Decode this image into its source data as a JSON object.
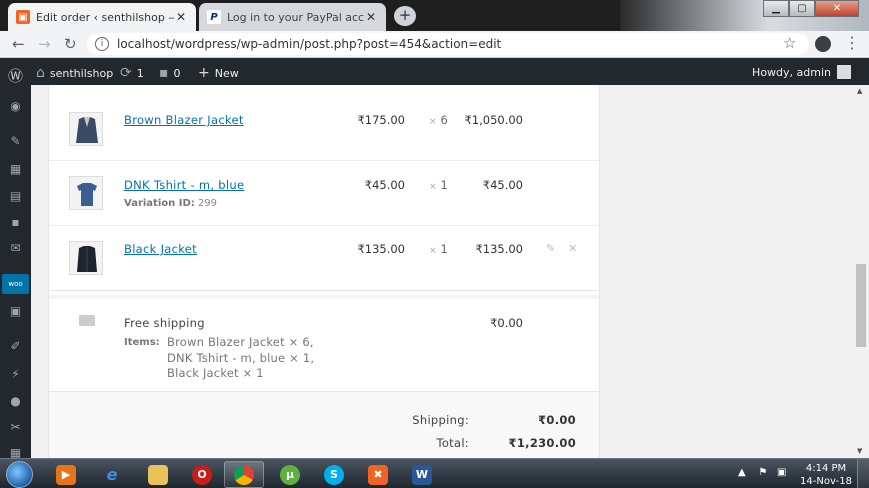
{
  "browser": {
    "tabs": [
      {
        "title": "Edit order ‹ senthilshop — Word",
        "active": true
      },
      {
        "title": "Log in to your PayPal account",
        "active": false
      }
    ],
    "url": "localhost/wordpress/wp-admin/post.php?post=454&action=edit"
  },
  "adminbar": {
    "site_name": "senthilshop",
    "updates_count": "1",
    "comments_count": "0",
    "new_label": "New",
    "greeting": "Howdy, admin"
  },
  "order_items": [
    {
      "name": "Brown Blazer Jacket",
      "cost": "₹175.00",
      "qty": "6",
      "total": "₹1,050.00"
    },
    {
      "name": "DNK Tshirt - m, blue",
      "variation_label": "Variation ID:",
      "variation_id": "299",
      "cost": "₹45.00",
      "qty": "1",
      "total": "₹45.00"
    },
    {
      "name": "Black Jacket",
      "cost": "₹135.00",
      "qty": "1",
      "total": "₹135.00"
    }
  ],
  "shipping": {
    "method": "Free shipping",
    "cost": "₹0.00",
    "items_label": "Items:",
    "items_lines": [
      "Brown Blazer Jacket × 6,",
      "DNK Tshirt - m, blue × 1,",
      "Black Jacket × 1"
    ]
  },
  "totals": {
    "shipping_label": "Shipping:",
    "shipping_value": "₹0.00",
    "total_label": "Total:",
    "total_value": "₹1,230.00"
  },
  "taskbar": {
    "time": "4:14 PM",
    "date": "14-Nov-18"
  },
  "colors": {
    "link": "#0073aa",
    "admin_bar": "#23282d",
    "woo_menu": "#0073aa"
  }
}
